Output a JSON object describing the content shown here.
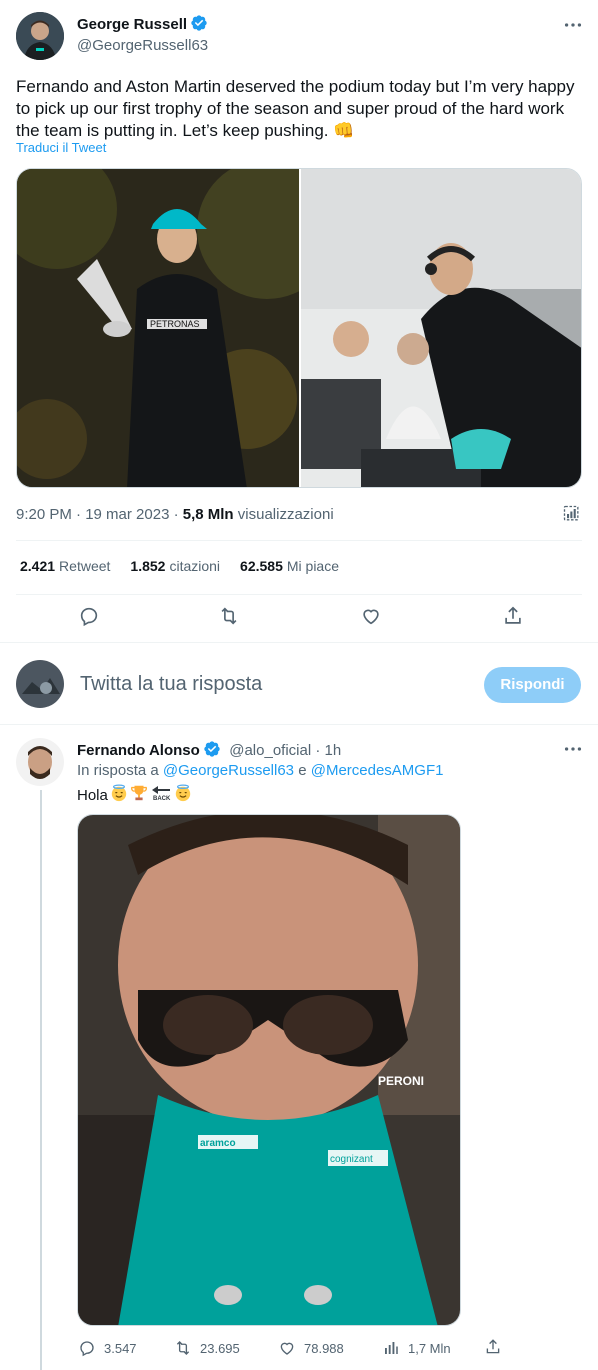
{
  "main_tweet": {
    "author_name": "George Russell",
    "author_handle": "@GeorgeRussell63",
    "text": "Fernando and Aston Martin deserved the podium today but I’m very happy to pick up our first trophy of the season and super proud of the hard work the team is putting in. Let’s keep pushing. 👊",
    "translate_label": "Traduci il Tweet",
    "time": "9:20 PM · 19 mar 2023 · ",
    "views_count": "5,8 Mln",
    "views_label": " visualizzazioni",
    "stats": {
      "retweets_num": "2.421",
      "retweets_label": "Retweet",
      "quotes_num": "1.852",
      "quotes_label": "citazioni",
      "likes_num": "62.585",
      "likes_label": "Mi piace"
    }
  },
  "reply_composer": {
    "placeholder": "Twitta la tua risposta",
    "button_label": "Rispondi"
  },
  "reply_tweet": {
    "author_name": "Fernando Alonso",
    "author_handle": "@alo_oficial",
    "time": " · 1h",
    "in_reply_prefix": "In risposta a ",
    "in_reply_user1": "@GeorgeRussell63",
    "in_reply_and": " e ",
    "in_reply_user2": "@MercedesAMGF1",
    "text": "Hola",
    "actions": {
      "replies": "3.547",
      "retweets": "23.695",
      "likes": "78.988",
      "views": "1,7 Mln"
    }
  },
  "colors": {
    "accent": "#1d9bf0",
    "text_primary": "#0f1419",
    "text_secondary": "#536471",
    "divider": "#eff3f4",
    "aston_green": "#00a19b"
  }
}
